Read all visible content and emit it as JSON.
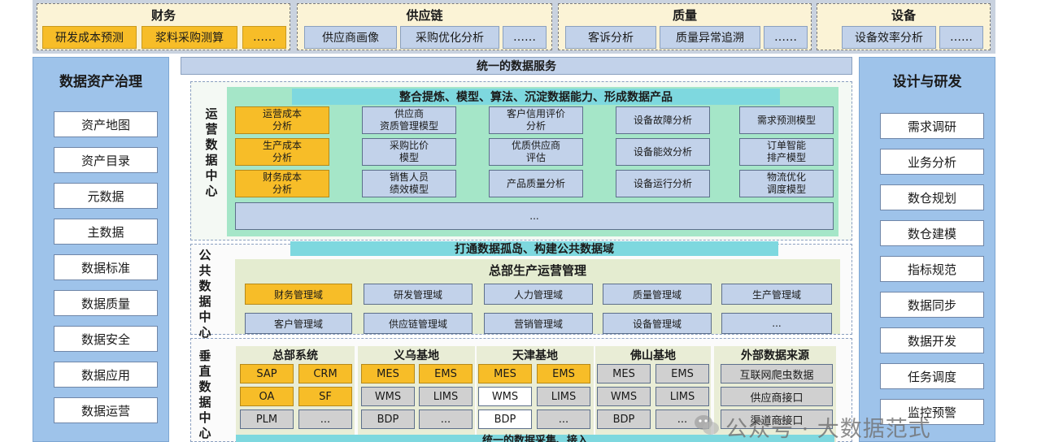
{
  "top_band": {
    "groups": [
      {
        "title": "财务",
        "items": [
          "研发成本预测",
          "浆料采购测算",
          "……"
        ],
        "item_styles": [
          "orange",
          "orange",
          "orange"
        ]
      },
      {
        "title": "供应链",
        "items": [
          "供应商画像",
          "采购优化分析",
          "……"
        ],
        "item_styles": [
          "blue",
          "blue",
          "blue"
        ]
      },
      {
        "title": "质量",
        "items": [
          "客诉分析",
          "质量异常追溯",
          "……"
        ],
        "item_styles": [
          "blue",
          "blue",
          "blue"
        ]
      },
      {
        "title": "设备",
        "items": [
          "设备效率分析",
          "……"
        ],
        "item_styles": [
          "blue",
          "blue"
        ]
      }
    ]
  },
  "left_panel": {
    "title": "数据资产治理",
    "items": [
      "资产地图",
      "资产目录",
      "元数据",
      "主数据",
      "数据标准",
      "数据质量",
      "数据安全",
      "数据应用",
      "数据运营"
    ]
  },
  "right_panel": {
    "title": "设计与研发",
    "items": [
      "需求调研",
      "业务分析",
      "数仓规划",
      "数仓建模",
      "指标规范",
      "数据同步",
      "数据开发",
      "任务调度",
      "监控预警"
    ]
  },
  "center": {
    "service_bar": "统一的数据服务",
    "ops_center": {
      "label": "运营数据中心",
      "banner": "整合提炼、模型、算法、沉淀数据能力、形成数据产品",
      "columns": [
        [
          "运营成本\n分析",
          "生产成本\n分析",
          "财务成本\n分析"
        ],
        [
          "供应商\n资质管理模型",
          "采购比价\n模型",
          "销售人员\n绩效模型"
        ],
        [
          "客户信用评价\n分析",
          "优质供应商\n评估",
          "产品质量分析"
        ],
        [
          "设备故障分析",
          "设备能效分析",
          "设备运行分析"
        ],
        [
          "需求预测模型",
          "订单智能\n排产模型",
          "物流优化\n调度模型"
        ]
      ],
      "more": "..."
    },
    "public_center": {
      "label": "公共数据中心",
      "banner": "打通数据孤岛、构建公共数据域",
      "subtitle": "总部生产运营管理",
      "rows": [
        [
          "财务管理域",
          "研发管理域",
          "人力管理域",
          "质量管理域",
          "生产管理域"
        ],
        [
          "客户管理域",
          "供应链管理域",
          "营销管理域",
          "设备管理域",
          "..."
        ]
      ]
    },
    "vertical_center": {
      "label": "垂直数据中心",
      "groups": [
        {
          "title": "总部系统",
          "items": [
            "SAP",
            "CRM",
            "OA",
            "SF",
            "PLM",
            "..."
          ],
          "styles": [
            "orange",
            "orange",
            "orange",
            "orange",
            "gray",
            "gray"
          ]
        },
        {
          "title": "义乌基地",
          "items": [
            "MES",
            "EMS",
            "WMS",
            "LIMS",
            "BDP",
            "..."
          ],
          "styles": [
            "orange",
            "orange",
            "gray",
            "gray",
            "gray",
            "gray"
          ]
        },
        {
          "title": "天津基地",
          "items": [
            "MES",
            "EMS",
            "WMS",
            "LIMS",
            "BDP",
            "..."
          ],
          "styles": [
            "orange",
            "orange",
            "white",
            "gray",
            "white",
            "gray"
          ]
        },
        {
          "title": "佛山基地",
          "items": [
            "MES",
            "EMS",
            "WMS",
            "LIMS",
            "BDP",
            "..."
          ],
          "styles": [
            "gray",
            "gray",
            "gray",
            "gray",
            "gray",
            "gray"
          ]
        },
        {
          "title": "外部数据来源",
          "items": [
            "互联网爬虫数据",
            "供应商接口",
            "渠道商接口"
          ],
          "styles": [
            "gray",
            "gray",
            "gray"
          ]
        }
      ]
    },
    "bottom_bar": "统一的数据采集、接入"
  },
  "watermark": "公众号 · 大数据范式",
  "colors": {
    "orange": "#f7bd28",
    "blue_box": "#c2d2ea",
    "side_panel": "#9ec3ea",
    "teal_banner": "#7ed8df",
    "green_area": "#a5e6c8",
    "cream_area": "#e4ecd0",
    "top_cream": "#fbf3d6"
  }
}
